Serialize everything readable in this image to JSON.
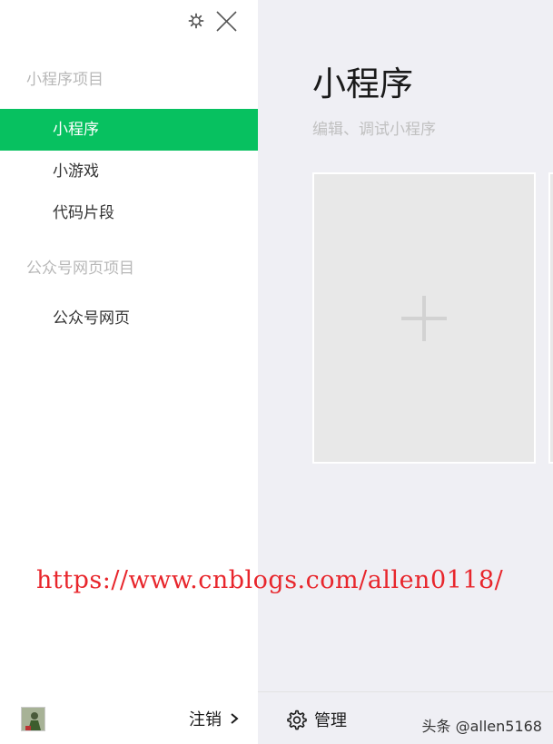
{
  "sidebar": {
    "sections": [
      {
        "title": "小程序项目",
        "items": [
          {
            "label": "小程序",
            "active": true
          },
          {
            "label": "小游戏"
          },
          {
            "label": "代码片段"
          }
        ]
      },
      {
        "title": "公众号网页项目",
        "items": [
          {
            "label": "公众号网页"
          }
        ]
      }
    ],
    "logout_label": "注销",
    "icons": {
      "settings": "gear-icon",
      "close": "close-icon",
      "logout_arrow": "chevron-right-icon",
      "avatar": "avatar"
    }
  },
  "main": {
    "title": "小程序",
    "subtitle": "编辑、调试小程序",
    "add_card_icon": "plus-icon",
    "manage_label": "管理",
    "manage_icon": "gear-icon"
  },
  "overlay": {
    "watermark_url": "https://www.cnblogs.com/allen0118/",
    "corner_credit": "头条 @allen5168"
  },
  "colors": {
    "accent": "#07c160",
    "watermark": "#e8262c",
    "main_bg": "#efeff4"
  }
}
